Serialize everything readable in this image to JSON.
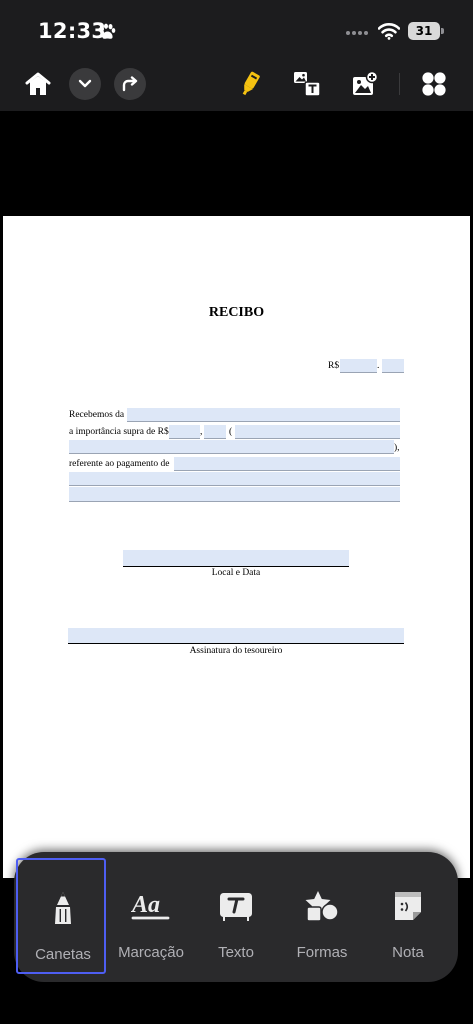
{
  "status_bar": {
    "time": "12:33",
    "battery": "31"
  },
  "toolbar": {
    "icons": [
      "home-icon",
      "chevron-down-icon",
      "redo-icon",
      "highlighter-icon",
      "image-text-icon",
      "add-image-icon",
      "grid-icon"
    ],
    "accent_color": "#f5c211"
  },
  "document": {
    "title": "RECIBO",
    "currency_label": "R$",
    "line_received": "Recebemos da",
    "line_amount": "a importância supra de R$",
    "amount_sep_dot": ".",
    "amount_sep_comma": ",",
    "paren_open": "(",
    "paren_close": "),",
    "line_reference": "referente ao pagamento de",
    "local_date_label": "Local e Data",
    "signature_label": "Assinatura do tesoureiro",
    "field_color": "#dde7f7"
  },
  "tools_panel": {
    "selected_color": "#4e5ef2",
    "items": [
      {
        "label": "Canetas",
        "icon": "pen-icon",
        "selected": true
      },
      {
        "label": "Marcação",
        "icon": "markup-text-icon",
        "selected": false
      },
      {
        "label": "Texto",
        "icon": "text-box-icon",
        "selected": false
      },
      {
        "label": "Formas",
        "icon": "shapes-icon",
        "selected": false
      },
      {
        "label": "Nota",
        "icon": "note-icon",
        "selected": false
      }
    ]
  }
}
